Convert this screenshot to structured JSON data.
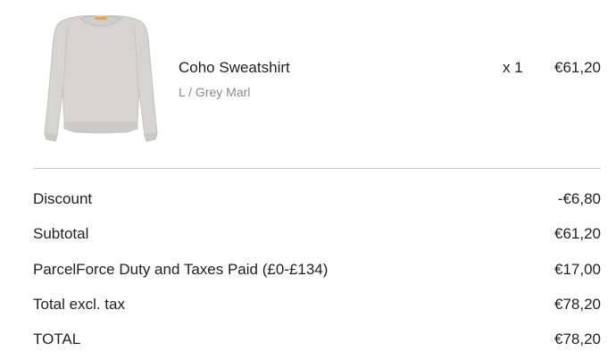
{
  "line_item": {
    "name": "Coho Sweatshirt",
    "variant": "L / Grey Marl",
    "quantity": "x 1",
    "price": "€61,20",
    "image": {
      "icon": "sweatshirt-icon",
      "color": "#d4d3d0",
      "collar_accent": "#f2a33a"
    }
  },
  "summary": {
    "discount": {
      "label": "Discount",
      "value": "-€6,80"
    },
    "subtotal": {
      "label": "Subtotal",
      "value": "€61,20"
    },
    "shipping": {
      "label": "ParcelForce Duty and Taxes Paid (£0-£134)",
      "value": "€17,00"
    },
    "total_excl_tax": {
      "label": "Total excl. tax",
      "value": "€78,20"
    },
    "total": {
      "label": "TOTAL",
      "value": "€78,20"
    }
  }
}
